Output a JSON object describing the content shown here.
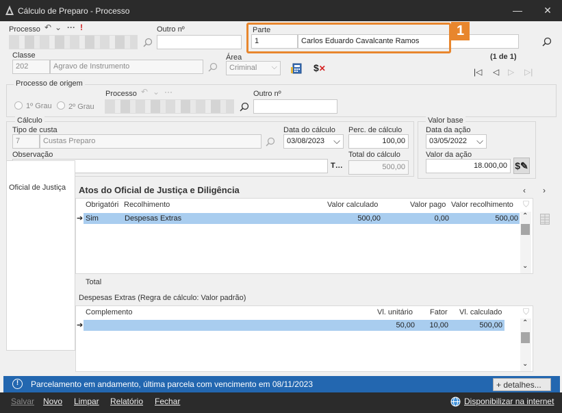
{
  "window": {
    "title": "Cálculo de Preparo - Processo"
  },
  "processo": {
    "label": "Processo",
    "outro_label": "Outro nº"
  },
  "parte": {
    "label": "Parte",
    "number": "1",
    "name": "Carlos Eduardo Cavalcante Ramos"
  },
  "classe": {
    "label": "Classe",
    "code": "202",
    "name": "Agravo de Instrumento"
  },
  "area": {
    "label": "Área",
    "value": "Criminal"
  },
  "pagination": {
    "text": "(1 de 1)"
  },
  "origem": {
    "label": "Processo de origem",
    "grau1": "1º Grau",
    "grau2": "2º Grau",
    "processo_label": "Processo",
    "outro_label": "Outro nº"
  },
  "calculo": {
    "label": "Cálculo",
    "tipo_label": "Tipo de custa",
    "tipo_code": "7",
    "tipo_name": "Custas Preparo",
    "data_label": "Data do cálculo",
    "data_value": "03/08/2023",
    "perc_label": "Perc. de cálculo",
    "perc_value": "100,00",
    "obs_label": "Observação",
    "total_label": "Total do cálculo",
    "total_value": "500,00"
  },
  "valor_base": {
    "label": "Valor base",
    "data_label": "Data da ação",
    "data_value": "03/05/2022",
    "valor_label": "Valor da ação",
    "valor_value": "18.000,00"
  },
  "tab": {
    "label": "Oficial de Justiça"
  },
  "atos": {
    "title": "Atos do Oficial de Justiça e Diligência",
    "headers": {
      "obrig": "Obrigatóri",
      "recolh": "Recolhimento",
      "vcalc": "Valor calculado",
      "vpago": "Valor pago",
      "vrecolh": "Valor recolhimento"
    },
    "row": {
      "obrig": "Sim",
      "recolh": "Despesas Extras",
      "vcalc": "500,00",
      "vpago": "0,00",
      "vrecolh": "500,00"
    },
    "total_label": "Total"
  },
  "despesas": {
    "title": "Despesas Extras (Regra de cálculo: Valor padrão)",
    "headers": {
      "compl": "Complemento",
      "vunit": "Vl. unitário",
      "fator": "Fator",
      "vcalc": "Vl. calculado"
    },
    "row": {
      "vunit": "50,00",
      "fator": "10,00",
      "vcalc": "500,00"
    }
  },
  "status": {
    "message": "Parcelamento em andamento, última parcela com vencimento em 08/11/2023",
    "detalhes": "+ detalhes..."
  },
  "actions": {
    "salvar": "Salvar",
    "novo": "Novo",
    "limpar": "Limpar",
    "relatorio": "Relatório",
    "fechar": "Fechar",
    "disponibilizar": "Disponibilizar na internet"
  },
  "callout": {
    "number": "1"
  },
  "colors": {
    "accent": "#e8862d",
    "status": "#2367b0",
    "titlebar": "#2b2b2b",
    "selection": "#a9cdef"
  }
}
